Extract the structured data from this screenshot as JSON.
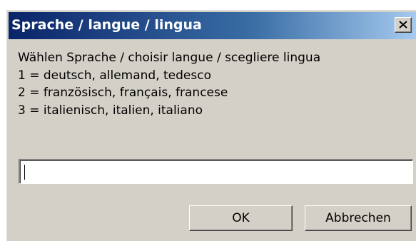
{
  "dialog": {
    "title": "Sprache / langue / lingua",
    "message_lines": [
      "Wählen Sprache / choisir langue / scegliere lingua",
      "1 = deutsch, allemand, tedesco",
      "2 = französisch, français, francese",
      "3 = italienisch, italien, italiano"
    ],
    "input": {
      "value": "",
      "placeholder": ""
    },
    "buttons": {
      "ok_label": "OK",
      "cancel_label": "Abbrechen"
    },
    "close_icon": "close-x"
  },
  "colors": {
    "face": "#d4d0c8",
    "title_gradient_start": "#0a246a",
    "title_gradient_end": "#a6caf0",
    "title_text": "#ffffff"
  }
}
